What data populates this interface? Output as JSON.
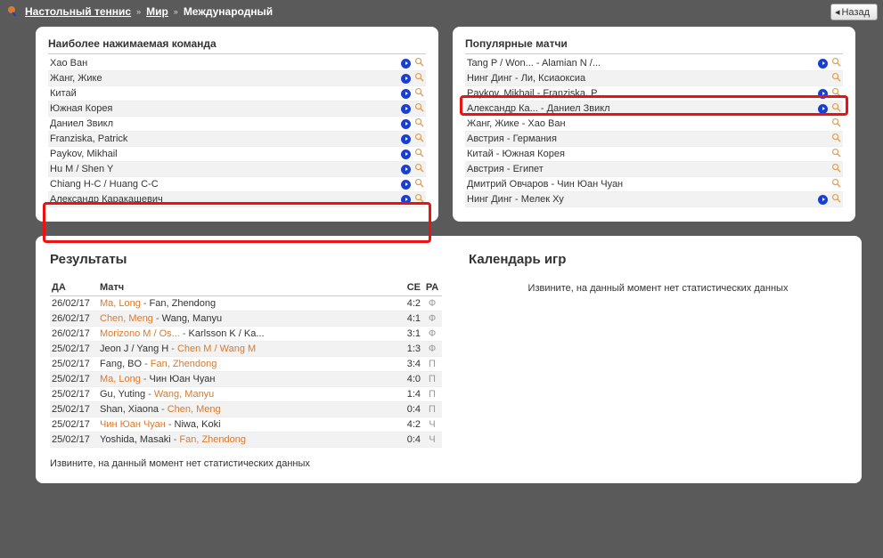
{
  "breadcrumb": {
    "sport": "Настольный теннис",
    "region": "Мир",
    "league": "Международный"
  },
  "back_label": "Назад",
  "left_panel": {
    "title": "Наиболее нажимаемая команда",
    "items": [
      {
        "label": "Хао Ван",
        "dot": true,
        "mag": true
      },
      {
        "label": "Жанг, Жике",
        "dot": true,
        "mag": true
      },
      {
        "label": "Китай",
        "dot": true,
        "mag": true
      },
      {
        "label": "Южная Корея",
        "dot": true,
        "mag": true
      },
      {
        "label": "Даниел Звикл",
        "dot": true,
        "mag": true
      },
      {
        "label": "Franziska, Patrick",
        "dot": true,
        "mag": true
      },
      {
        "label": "Paykov, Mikhail",
        "dot": true,
        "mag": true
      },
      {
        "label": "Hu M / Shen Y",
        "dot": true,
        "mag": true
      },
      {
        "label": "Chiang H-C / Huang C-C",
        "dot": true,
        "mag": true
      },
      {
        "label": "Александр Каракашевич",
        "dot": true,
        "mag": true
      }
    ]
  },
  "right_panel": {
    "title": "Популярные матчи",
    "items": [
      {
        "label": "Tang P / Won... - Alamian N /...",
        "dot": true,
        "mag": true
      },
      {
        "label": "Нинг Динг - Ли, Ксиаоксиа",
        "dot": false,
        "mag": true
      },
      {
        "label": "Paykov, Mikhail - Franziska, P...",
        "dot": true,
        "mag": true
      },
      {
        "label": "Александр Ка... - Даниел Звикл",
        "dot": true,
        "mag": true
      },
      {
        "label": "Жанг, Жике - Хао Ван",
        "dot": false,
        "mag": true
      },
      {
        "label": "Австрия - Германия",
        "dot": false,
        "mag": true
      },
      {
        "label": "Китай - Южная Корея",
        "dot": false,
        "mag": true
      },
      {
        "label": "Австрия - Египет",
        "dot": false,
        "mag": true
      },
      {
        "label": "Дмитрий Овчаров - Чин Юан Чуан",
        "dot": false,
        "mag": true
      },
      {
        "label": "Нинг Динг - Мелек Ху",
        "dot": true,
        "mag": true
      }
    ]
  },
  "results": {
    "title": "Результаты",
    "headers": {
      "date": "ДА",
      "match": "Матч",
      "se": "СЕ",
      "ra": "РА"
    },
    "rows": [
      {
        "date": "26/02/17",
        "p1": "Ma, Long",
        "p2": "Fan, Zhendong",
        "p1_loser": false,
        "p2_loser": true,
        "se": "4:2",
        "ra": "Ф"
      },
      {
        "date": "26/02/17",
        "p1": "Chen, Meng",
        "p2": "Wang, Manyu",
        "p1_loser": false,
        "p2_loser": true,
        "se": "4:1",
        "ra": "Ф"
      },
      {
        "date": "26/02/17",
        "p1": "Morizono M / Os...",
        "p2": "Karlsson K / Ka...",
        "p1_loser": false,
        "p2_loser": true,
        "se": "3:1",
        "ra": "Ф"
      },
      {
        "date": "25/02/17",
        "p1": "Jeon J / Yang H",
        "p2": "Chen M / Wang M",
        "p1_loser": true,
        "p2_loser": false,
        "se": "1:3",
        "ra": "Ф"
      },
      {
        "date": "25/02/17",
        "p1": "Fang, BO",
        "p2": "Fan, Zhendong",
        "p1_loser": true,
        "p2_loser": false,
        "se": "3:4",
        "ra": "П"
      },
      {
        "date": "25/02/17",
        "p1": "Ma, Long",
        "p2": "Чин Юан Чуан",
        "p1_loser": false,
        "p2_loser": true,
        "se": "4:0",
        "ra": "П"
      },
      {
        "date": "25/02/17",
        "p1": "Gu, Yuting",
        "p2": "Wang, Manyu",
        "p1_loser": true,
        "p2_loser": false,
        "se": "1:4",
        "ra": "П"
      },
      {
        "date": "25/02/17",
        "p1": "Shan, Xiaona",
        "p2": "Chen, Meng",
        "p1_loser": true,
        "p2_loser": false,
        "se": "0:4",
        "ra": "П"
      },
      {
        "date": "25/02/17",
        "p1": "Чин Юан Чуан",
        "p2": "Niwa, Koki",
        "p1_loser": false,
        "p2_loser": true,
        "se": "4:2",
        "ra": "Ч"
      },
      {
        "date": "25/02/17",
        "p1": "Yoshida, Masaki",
        "p2": "Fan, Zhendong",
        "p1_loser": true,
        "p2_loser": false,
        "se": "0:4",
        "ra": "Ч"
      }
    ],
    "no_data_left": "Извините, на данный момент нет статистических данных"
  },
  "calendar": {
    "title": "Календарь игр",
    "no_data": "Извините, на данный момент нет статистических данных"
  }
}
